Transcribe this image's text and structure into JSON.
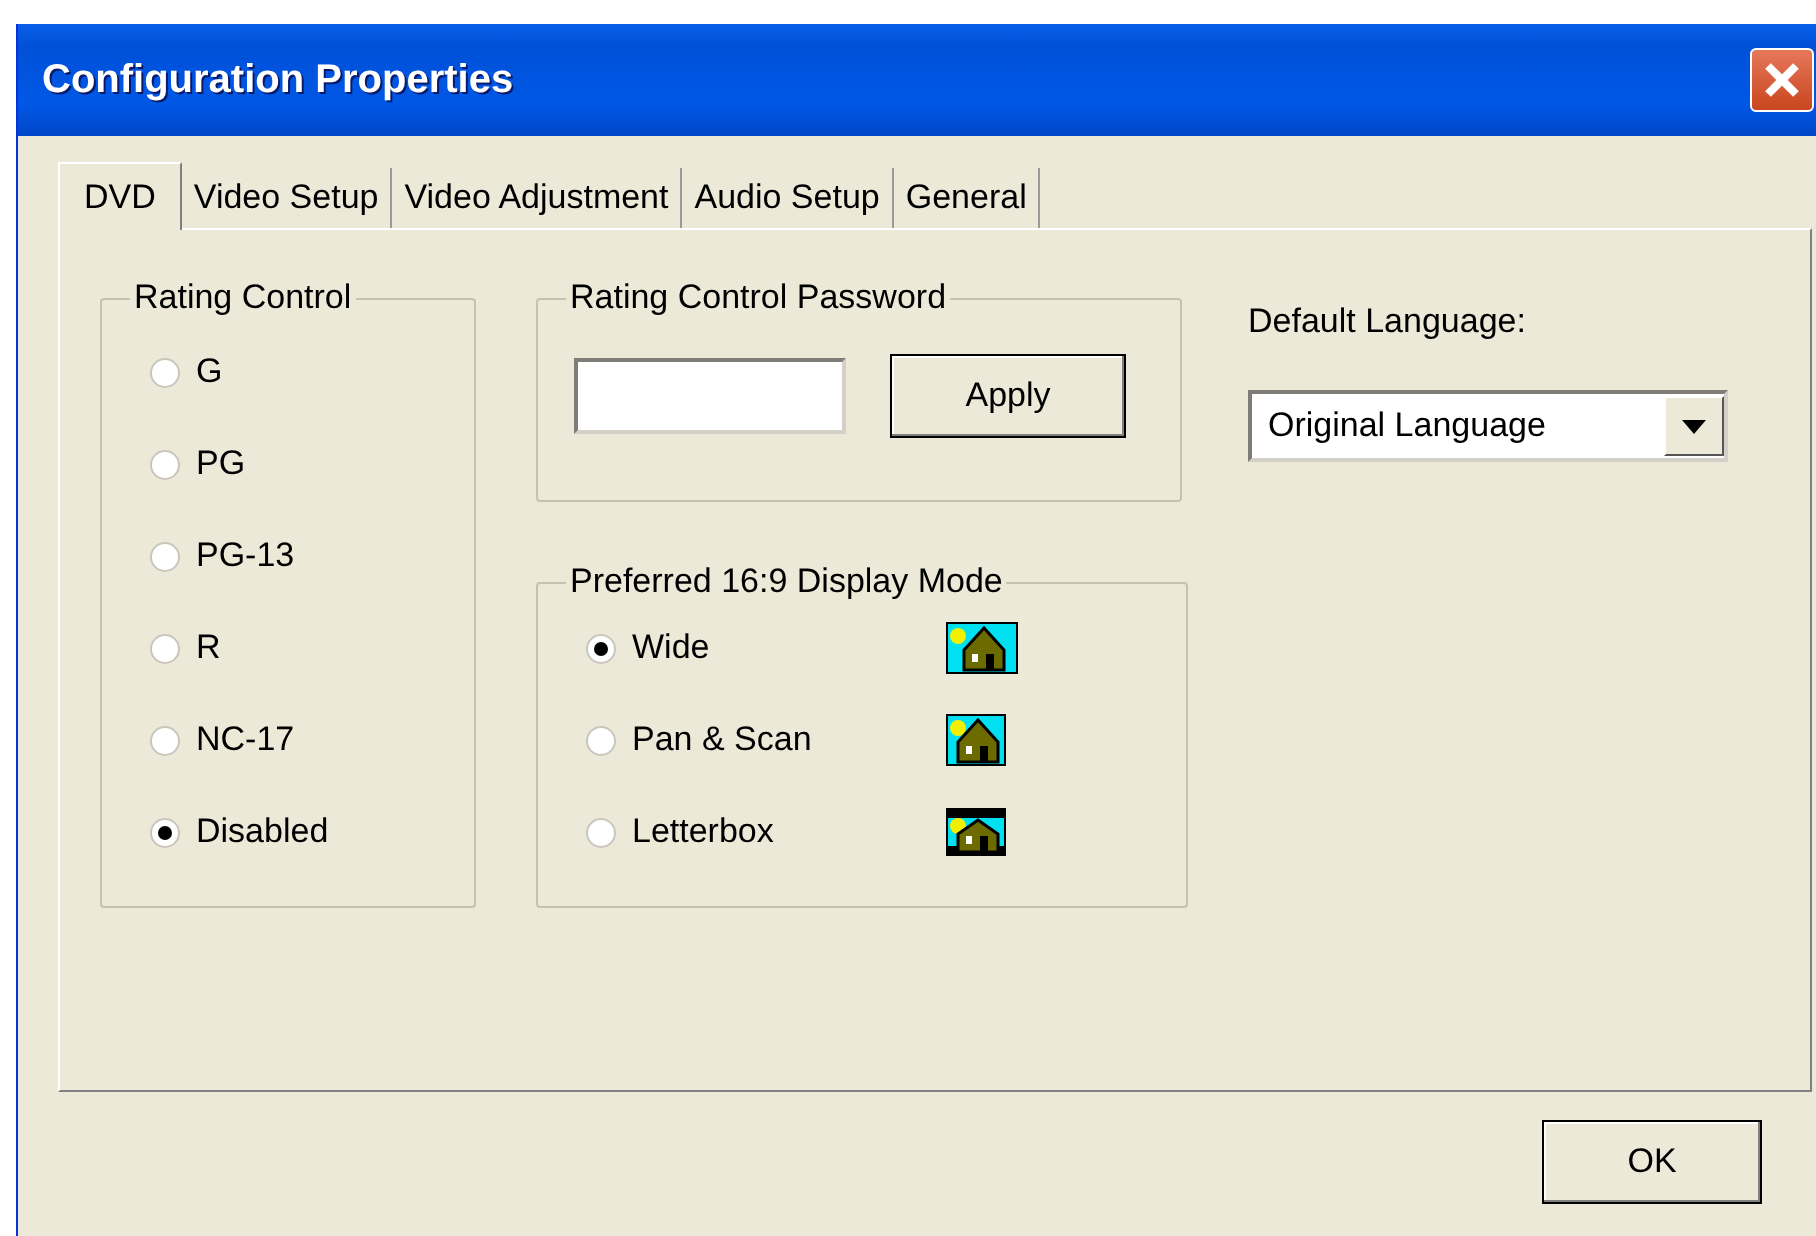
{
  "window": {
    "title": "Configuration Properties"
  },
  "tabs": [
    {
      "label": "DVD",
      "selected": true
    },
    {
      "label": "Video Setup",
      "selected": false
    },
    {
      "label": "Video Adjustment",
      "selected": false
    },
    {
      "label": "Audio Setup",
      "selected": false
    },
    {
      "label": "General",
      "selected": false
    }
  ],
  "rating_control": {
    "title": "Rating Control",
    "options": [
      {
        "label": "G",
        "selected": false
      },
      {
        "label": "PG",
        "selected": false
      },
      {
        "label": "PG-13",
        "selected": false
      },
      {
        "label": "R",
        "selected": false
      },
      {
        "label": "NC-17",
        "selected": false
      },
      {
        "label": "Disabled",
        "selected": true
      }
    ]
  },
  "rating_password": {
    "title": "Rating Control Password",
    "button": "Apply"
  },
  "display_mode": {
    "title": "Preferred 16:9 Display Mode",
    "options": [
      {
        "label": "Wide",
        "selected": true,
        "kind": "wide"
      },
      {
        "label": "Pan & Scan",
        "selected": false,
        "kind": "pan_scan"
      },
      {
        "label": "Letterbox",
        "selected": false,
        "kind": "letterbox"
      }
    ]
  },
  "default_language": {
    "label": "Default Language:",
    "value": "Original Language"
  },
  "buttons": [
    "OK"
  ]
}
